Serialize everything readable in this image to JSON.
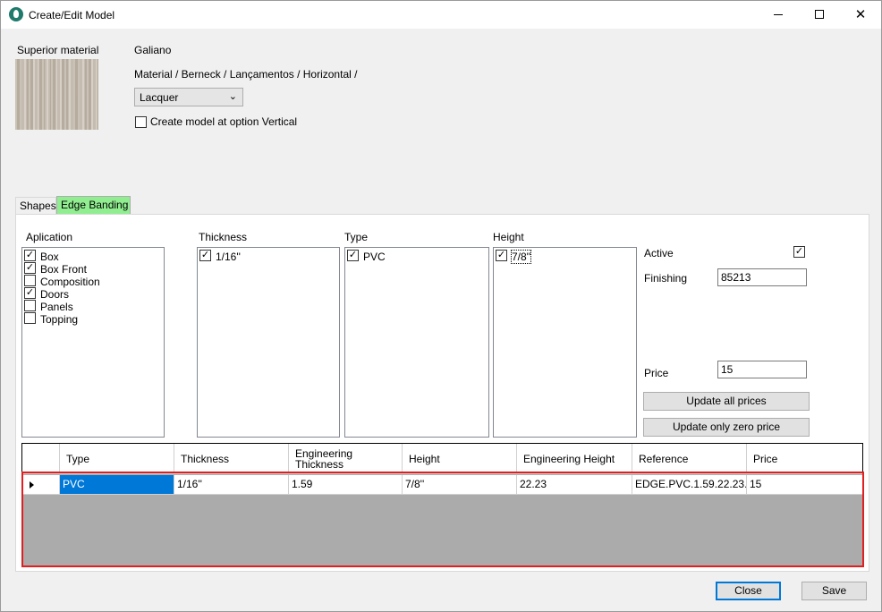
{
  "window": {
    "title": "Create/Edit Model",
    "minimize": "minimize",
    "maximize": "maximize",
    "close_glyph": "✕"
  },
  "header": {
    "superior_material_label": "Superior material",
    "material_name": "Galiano",
    "material_path": "Material / Berneck / Lançamentos / Horizontal /",
    "finish_select": "Lacquer",
    "vertical_option_label": "Create model at option Vertical",
    "vertical_option_checked": false
  },
  "tabs": [
    {
      "label": "Shapes",
      "active": false
    },
    {
      "label": "Edge Banding",
      "active": true,
      "color": "#90ee90"
    }
  ],
  "edge_banding": {
    "application": {
      "label": "Aplication",
      "items": [
        {
          "label": "Box",
          "checked": true
        },
        {
          "label": "Box Front",
          "checked": true
        },
        {
          "label": "Composition",
          "checked": false
        },
        {
          "label": "Doors",
          "checked": true
        },
        {
          "label": "Panels",
          "checked": false
        },
        {
          "label": "Topping",
          "checked": false
        }
      ]
    },
    "thickness": {
      "label": "Thickness",
      "items": [
        {
          "label": "1/16''",
          "checked": true
        }
      ]
    },
    "type": {
      "label": "Type",
      "items": [
        {
          "label": "PVC",
          "checked": true
        }
      ]
    },
    "height": {
      "label": "Height",
      "items": [
        {
          "label": "7/8''",
          "checked": true
        }
      ]
    },
    "active_label": "Active",
    "active_checked": true,
    "finishing_label": "Finishing",
    "finishing_value": "85213",
    "price_label": "Price",
    "price_value": "15",
    "update_all_label": "Update all prices",
    "update_zero_label": "Update only zero price"
  },
  "grid": {
    "columns": [
      "Type",
      "Thickness",
      "Engineering Thickness",
      "Height",
      "Engineering Height",
      "Reference",
      "Price"
    ],
    "rows": [
      {
        "type": "PVC",
        "thickness": "1/16''",
        "eng_thickness": "1.59",
        "height": "7/8''",
        "eng_height": "22.23",
        "reference": "EDGE.PVC.1.59.22.23....",
        "price": "15"
      }
    ]
  },
  "footer": {
    "close_label": "Close",
    "save_label": "Save"
  },
  "colors": {
    "selection": "#0078d7",
    "highlight_border": "#e02020",
    "tab_active": "#90ee90"
  }
}
